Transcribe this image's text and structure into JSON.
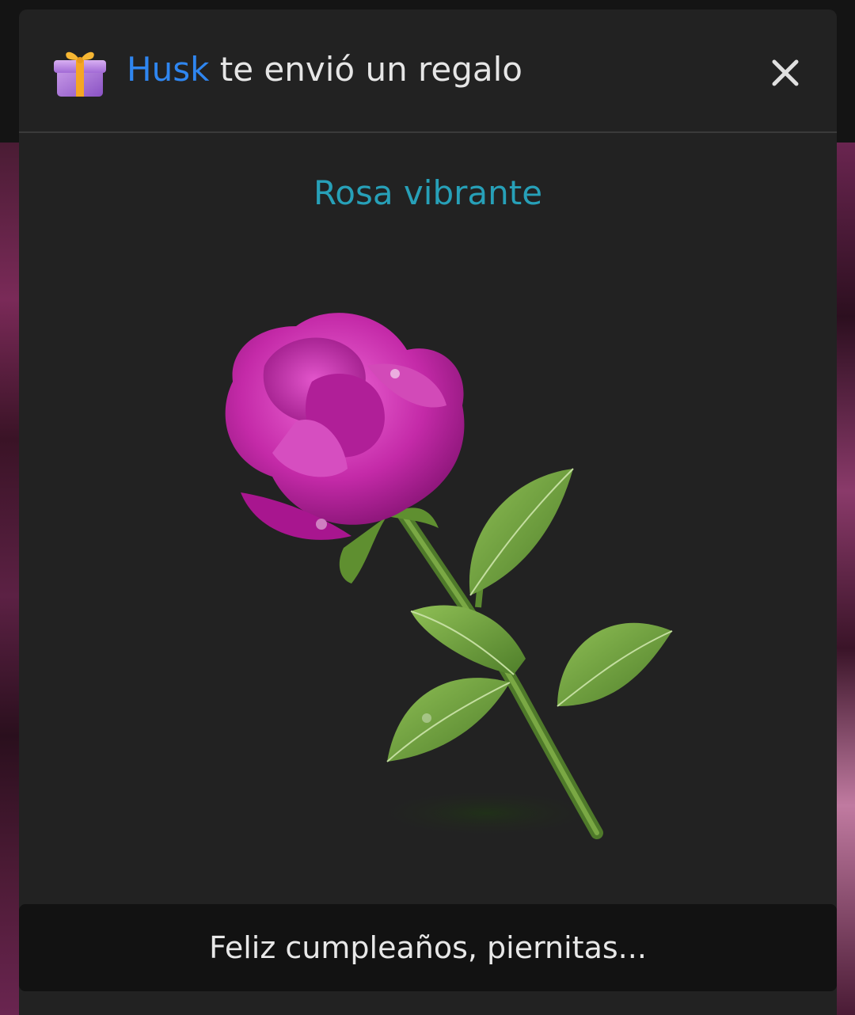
{
  "gift_notification": {
    "sender": "Husk",
    "title_suffix": " te envió un regalo",
    "gift_name": "Rosa vibrante",
    "message": "Feliz cumpleaños, piernitas...",
    "gift_icon": "gift-icon",
    "close_icon": "close-icon",
    "gift_image": "pink-rose-image"
  },
  "colors": {
    "modal_background": "#222222",
    "sender_link": "#2f86f0",
    "gift_name": "#27a0b8",
    "title_text": "#e6e6e6",
    "message_bar": "#121212",
    "message_text": "#e8e8e8",
    "rose_petal": "#c42aa8",
    "leaf": "#6e9e3a"
  }
}
